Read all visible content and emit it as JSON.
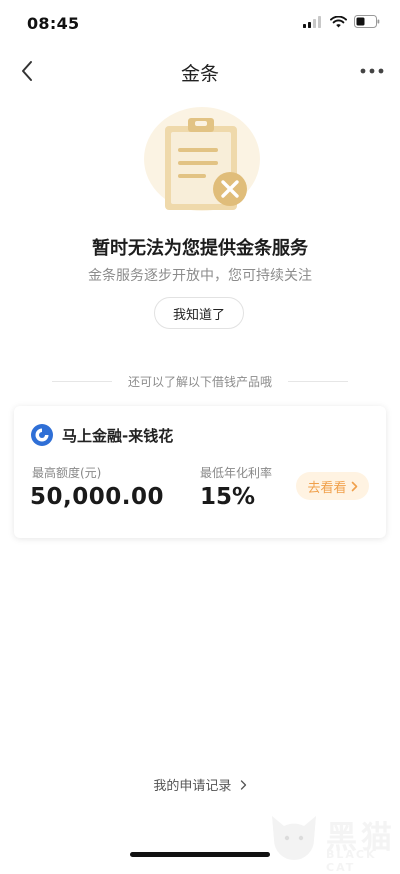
{
  "status_bar": {
    "time": "08:45"
  },
  "nav": {
    "title": "金条",
    "back_icon": "chevron-left-icon",
    "more_icon": "more-dots-icon"
  },
  "empty_state": {
    "illustration": "clipboard-cross-icon",
    "title": "暂时无法为您提供金条服务",
    "subtitle": "金条服务逐步开放中，您可持续关注",
    "ack_label": "我知道了"
  },
  "recommend": {
    "divider_text": "还可以了解以下借钱产品哦"
  },
  "product": {
    "logo_icon": "mashang-finance-logo",
    "name": "马上金融-来钱花",
    "limit_label": "最高额度(元)",
    "limit_value": "50,000.00",
    "rate_label": "最低年化利率",
    "rate_value": "15%",
    "go_label": "去看看",
    "go_icon": "chevron-right-icon"
  },
  "footer": {
    "record_label": "我的申请记录",
    "record_icon": "chevron-right-icon"
  },
  "watermark": {
    "cn": "黑猫",
    "en": "BLACK CAT"
  },
  "colors": {
    "accent_orange": "#f0a04b",
    "accent_orange_bg": "#fff3e2",
    "logo_blue": "#2f6fd6"
  }
}
